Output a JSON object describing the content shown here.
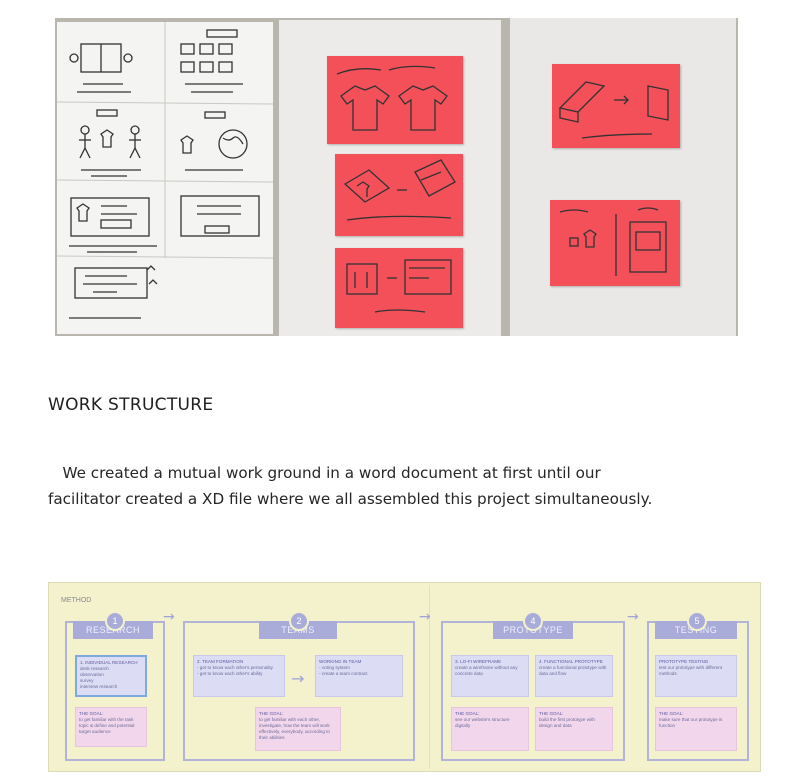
{
  "heading": "WORK STRUCTURE",
  "body": {
    "line1": "   We created a mutual work ground in a word document at first until our",
    "line2": "facilitator created a XD file where we all assembled this project simultaneously."
  },
  "photo": {
    "description_icon": "sketch-photo-icon"
  },
  "method": {
    "label": "METHOD",
    "stages": [
      {
        "number": "1",
        "title": "RESEARCH",
        "boxes": [
          {
            "title": "1. INDIVIDUAL RESEARCH",
            "text": "desk research\nobservation\nsurvey\ninterview research"
          },
          {
            "title": "THE GOAL:",
            "text": "to get familiar with the task topic & define and potential target audience"
          }
        ]
      },
      {
        "number": "2",
        "title": "TEAMS",
        "boxes": [
          {
            "title": "2. TEAM FORMATION",
            "text": "- get to know each other's personality\n- get to know each other's ability"
          },
          {
            "title": "WORKING IN TEAM",
            "text": "- voting system\n- create a team contract"
          },
          {
            "title": "THE GOAL:",
            "text": "to get familiar with each other, investigate, how the team will work effectively, everybody, according to their abilities"
          }
        ]
      },
      {
        "number": "4",
        "title": "PROTOTYPE",
        "boxes": [
          {
            "title": "3. LO-FI WIREFRAME",
            "text": "create a wireframe without any concrete data"
          },
          {
            "title": "4. FUNCTIONAL PROTOTYPE",
            "text": "create a functional prototype with data and flow"
          },
          {
            "title": "THE GOAL:",
            "text": "see our website's structure digitally"
          },
          {
            "title": "THE GOAL:",
            "text": "build the first prototype with design and data"
          }
        ]
      },
      {
        "number": "5",
        "title": "TESTING",
        "boxes": [
          {
            "title": "PROTOTYPE TESTING",
            "text": "test our prototype with different methods"
          },
          {
            "title": "THE GOAL:",
            "text": "make sure that our prototype is function"
          }
        ]
      }
    ]
  },
  "colors": {
    "note": "#f4505a",
    "method_bg": "#f4f1cd",
    "stage_accent": "#a9acd9"
  }
}
